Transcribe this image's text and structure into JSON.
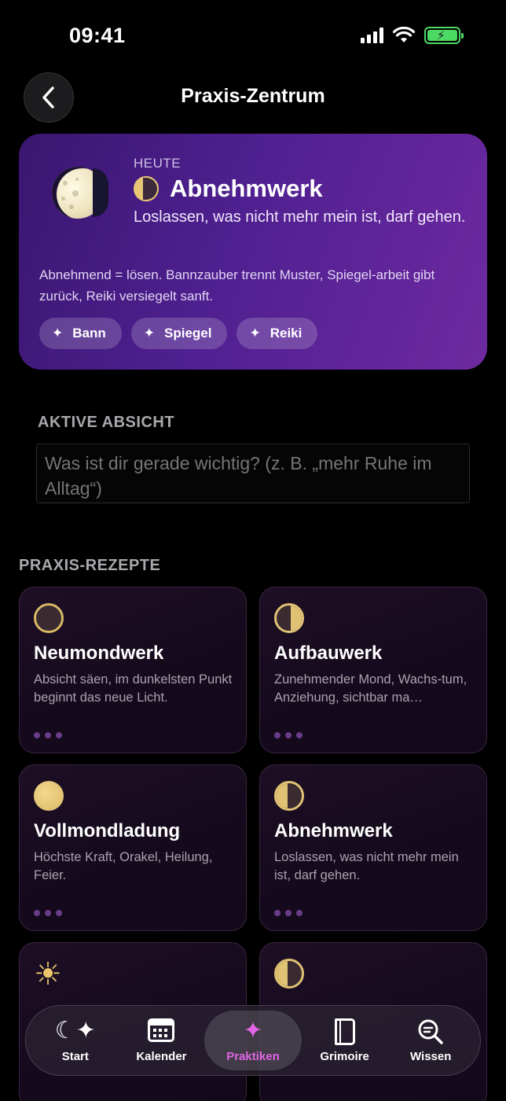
{
  "status": {
    "time": "09:41"
  },
  "header": {
    "title": "Praxis-Zentrum"
  },
  "today": {
    "label": "HEUTE",
    "title": "Abnehmwerk",
    "subtitle": "Loslassen, was nicht mehr mein ist, darf gehen.",
    "description": "Abnehmend = lösen. Bannzauber trennt Muster, Spiegel-arbeit gibt zurück, Reiki versiegelt sanft.",
    "chips": [
      "Bann",
      "Spiegel",
      "Reiki"
    ]
  },
  "intent": {
    "label": "AKTIVE ABSICHT",
    "placeholder": "Was ist dir gerade wichtig? (z. B. „mehr Ruhe im Alltag“)"
  },
  "recipes": {
    "label": "PRAXIS-REZEPTE",
    "items": [
      {
        "title": "Neumondwerk",
        "desc": "Absicht säen, im dunkelsten Punkt beginnt das neue Licht.",
        "icon": "new-moon-icon"
      },
      {
        "title": "Aufbauwerk",
        "desc": "Zunehmender Mond, Wachs-tum, Anziehung, sichtbar ma…",
        "icon": "waxing-moon-icon"
      },
      {
        "title": "Vollmondladung",
        "desc": "Höchste Kraft, Orakel, Heilung, Feier.",
        "icon": "full-moon-icon"
      },
      {
        "title": "Abnehmwerk",
        "desc": "Loslassen, was nicht mehr mein ist, darf gehen.",
        "icon": "waning-moon-icon"
      },
      {
        "title": "",
        "desc": "",
        "icon": "sun-icon"
      },
      {
        "title": "",
        "desc": "",
        "icon": "waning-moon-icon"
      }
    ]
  },
  "tabs": [
    {
      "label": "Start",
      "icon": "moon-stars-icon",
      "active": false
    },
    {
      "label": "Kalender",
      "icon": "calendar-icon",
      "active": false
    },
    {
      "label": "Praktiken",
      "icon": "sparkles-icon",
      "active": true
    },
    {
      "label": "Grimoire",
      "icon": "book-icon",
      "active": false
    },
    {
      "label": "Wissen",
      "icon": "magnifier-icon",
      "active": false
    }
  ],
  "colors": {
    "accent": "#e066e6",
    "gold": "#e0c274",
    "card_gradient_start": "#3a1670",
    "card_gradient_end": "#6e2aa0"
  }
}
